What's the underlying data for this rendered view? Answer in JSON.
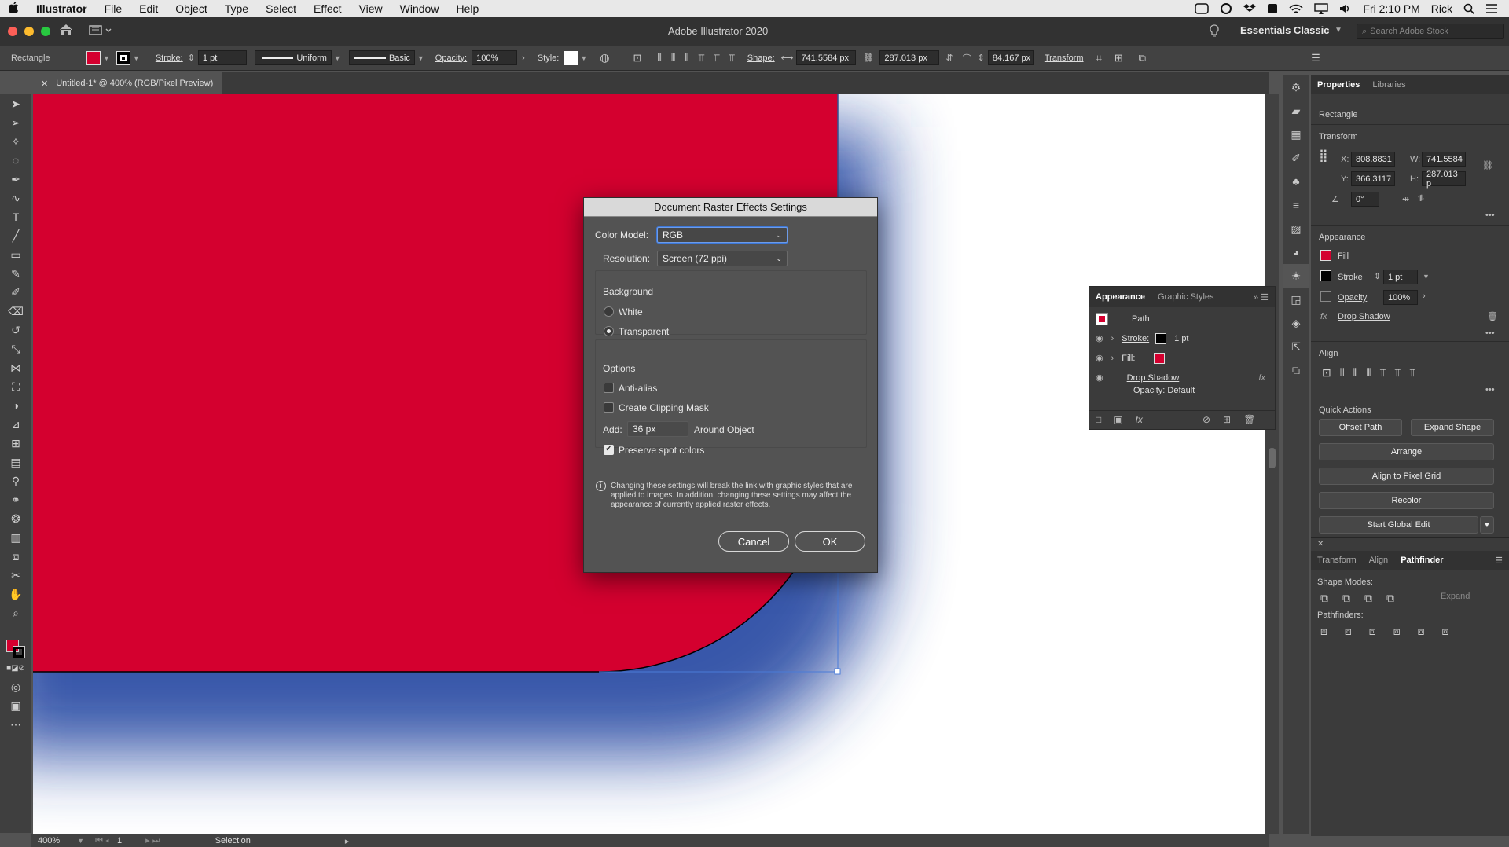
{
  "menubar": {
    "apple": "",
    "app": "Illustrator",
    "items": [
      "File",
      "Edit",
      "Object",
      "Type",
      "Select",
      "Effect",
      "View",
      "Window",
      "Help"
    ],
    "clock": "Fri 2:10 PM",
    "user": "Rick"
  },
  "appbar": {
    "title": "Adobe Illustrator 2020",
    "workspace": "Essentials Classic",
    "search_placeholder": "Search Adobe Stock"
  },
  "control": {
    "selection": "Rectangle",
    "stroke_label": "Stroke:",
    "stroke_value": "1 pt",
    "stroke_profile": "Uniform",
    "brush": "Basic",
    "opacity_label": "Opacity:",
    "opacity_value": "100%",
    "style_label": "Style:",
    "shape_label": "Shape:",
    "width": "741.5584 px",
    "height": "287.013 px",
    "corner": "84.167 px",
    "transform": "Transform",
    "fill_color": "#d4002f"
  },
  "document": {
    "tab": "Untitled-1* @ 400% (RGB/Pixel Preview)"
  },
  "status": {
    "zoom": "400%",
    "artboard": "1",
    "tool": "Selection"
  },
  "dialog": {
    "title": "Document Raster Effects Settings",
    "color_model_label": "Color Model:",
    "color_model": "RGB",
    "resolution_label": "Resolution:",
    "resolution": "Screen (72 ppi)",
    "background_label": "Background",
    "white": "White",
    "transparent": "Transparent",
    "options_label": "Options",
    "anti_alias": "Anti-alias",
    "clipping_mask": "Create Clipping Mask",
    "add_label": "Add:",
    "add_value": "36 px",
    "around": "Around Object",
    "preserve": "Preserve spot colors",
    "info": "Changing these settings will break the link with graphic styles that are applied to images. In addition, changing these settings may affect the appearance of currently applied raster effects.",
    "cancel": "Cancel",
    "ok": "OK"
  },
  "appearance": {
    "tab1": "Appearance",
    "tab2": "Graphic Styles",
    "path": "Path",
    "stroke_label": "Stroke:",
    "stroke_value": "1 pt",
    "fill_label": "Fill:",
    "drop_shadow": "Drop Shadow",
    "opacity_row": "Opacity: Default"
  },
  "props": {
    "tab1": "Properties",
    "tab2": "Libraries",
    "object": "Rectangle",
    "transform": "Transform",
    "x_label": "X:",
    "x": "808.8831",
    "y_label": "Y:",
    "y": "366.3117",
    "w_label": "W:",
    "w": "741.5584",
    "h_label": "H:",
    "h": "287.013 p",
    "angle": "0°",
    "appearance": "Appearance",
    "fill": "Fill",
    "stroke": "Stroke",
    "stroke_value": "1 pt",
    "opacity": "Opacity",
    "opacity_value": "100%",
    "drop_shadow": "Drop Shadow",
    "align": "Align",
    "quick_actions": "Quick Actions",
    "offset_path": "Offset Path",
    "expand_shape": "Expand Shape",
    "arrange": "Arrange",
    "align_pixel": "Align to Pixel Grid",
    "recolor": "Recolor",
    "global_edit": "Start Global Edit",
    "tab_transform": "Transform",
    "tab_align": "Align",
    "tab_pathfinder": "Pathfinder",
    "shape_modes": "Shape Modes:",
    "expand": "Expand",
    "pathfinders": "Pathfinders:"
  },
  "colors": {
    "fill": "#d4002f",
    "shadow": "#2d4fa6",
    "selection": "#4a7bd8"
  }
}
